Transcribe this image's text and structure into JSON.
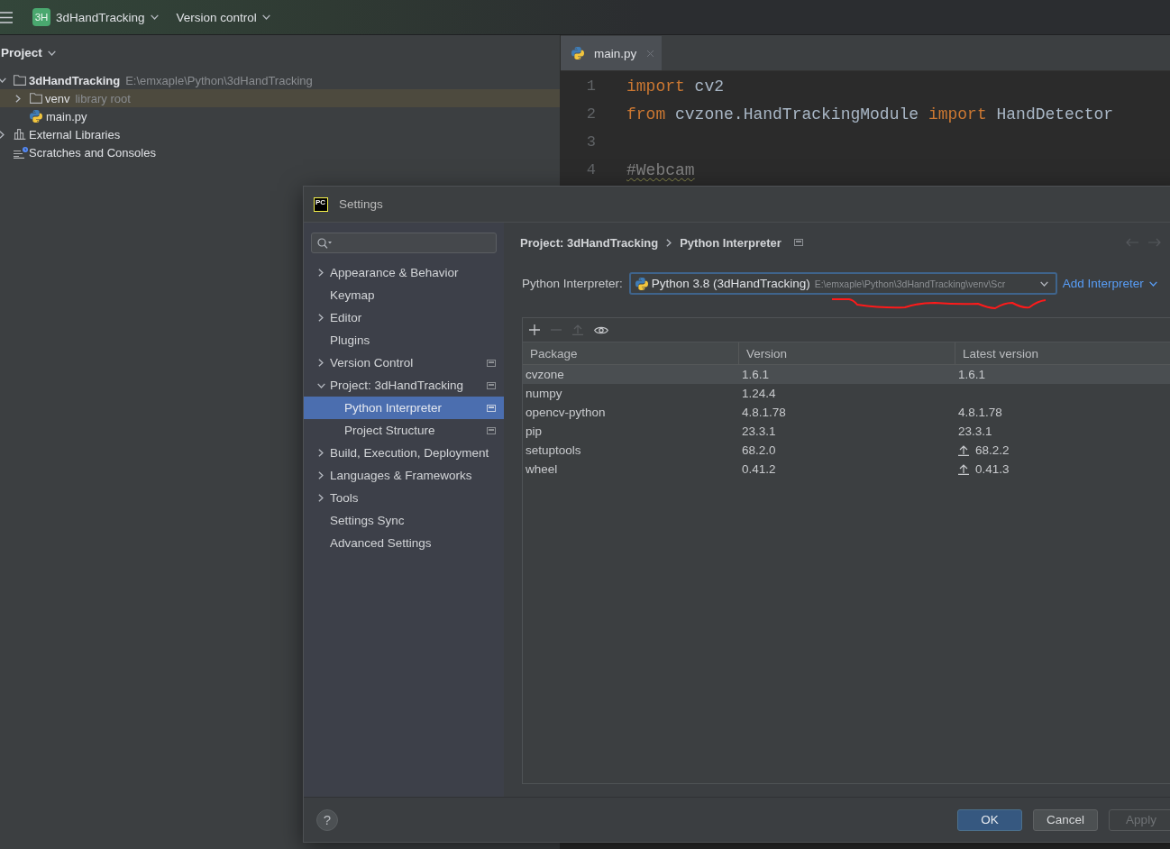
{
  "main_toolbar": {
    "project_badge": "3H",
    "project": "3dHandTracking",
    "vcs": "Version control"
  },
  "project_panel": {
    "title": "Project",
    "tree": [
      {
        "kind": "project",
        "name": "3dHandTracking",
        "hint": "E:\\emxaple\\Python\\3dHandTracking",
        "expanded": true,
        "selected": false,
        "children": [
          {
            "kind": "folder",
            "name": "venv",
            "hint": "library root",
            "expanded": false,
            "selected": true
          },
          {
            "kind": "python",
            "name": "main.py",
            "selected": false
          }
        ]
      },
      {
        "kind": "libraries",
        "name": "External Libraries",
        "expanded": false,
        "selected": false
      },
      {
        "kind": "scratches",
        "name": "Scratches and Consoles",
        "selected": false
      }
    ]
  },
  "editor": {
    "tabs": [
      {
        "label": "main.py",
        "selected": true
      }
    ],
    "lines": [
      {
        "number": "1",
        "tokens": [
          {
            "kind": "keyword",
            "text": "import"
          },
          {
            "kind": "plain",
            "text": " cv2"
          }
        ]
      },
      {
        "number": "2",
        "tokens": [
          {
            "kind": "keyword",
            "text": "from"
          },
          {
            "kind": "plain",
            "text": " cvzone.HandTrackingModule "
          },
          {
            "kind": "keyword",
            "text": "import"
          },
          {
            "kind": "plain",
            "text": " HandDetector"
          }
        ]
      },
      {
        "number": "3"
      },
      {
        "number": "4",
        "tokens": [
          {
            "kind": "comment",
            "text": "#Webcam",
            "typo": true
          }
        ]
      }
    ]
  },
  "settings_dialog": {
    "logo": "PC",
    "title": "Settings",
    "nav": [
      {
        "label": "Appearance & Behavior",
        "expanded": false,
        "project_scope": false,
        "selected": false
      },
      {
        "label": "Keymap",
        "project_scope": false,
        "selected": false
      },
      {
        "label": "Editor",
        "expanded": false,
        "project_scope": false,
        "selected": false
      },
      {
        "label": "Plugins",
        "project_scope": false,
        "selected": false
      },
      {
        "label": "Version Control",
        "expanded": false,
        "project_scope": true,
        "selected": false
      },
      {
        "label": "Project: 3dHandTracking",
        "expanded": true,
        "project_scope": true,
        "selected": false,
        "children": [
          {
            "label": "Python Interpreter",
            "project_scope": true,
            "selected": true
          },
          {
            "label": "Project Structure",
            "project_scope": true,
            "selected": false
          }
        ]
      },
      {
        "label": "Build, Execution, Deployment",
        "expanded": false,
        "project_scope": false,
        "selected": false
      },
      {
        "label": "Languages & Frameworks",
        "expanded": false,
        "project_scope": false,
        "selected": false
      },
      {
        "label": "Tools",
        "expanded": false,
        "project_scope": false,
        "selected": false
      },
      {
        "label": "Settings Sync",
        "project_scope": false,
        "selected": false
      },
      {
        "label": "Advanced Settings",
        "project_scope": false,
        "selected": false
      }
    ],
    "breadcrumb": [
      "Project: 3dHandTracking",
      "Python Interpreter"
    ],
    "interpreter": {
      "label": "Python Interpreter:",
      "value": "Python 3.8 (3dHandTracking)",
      "path": "E:\\emxaple\\Python\\3dHandTracking\\venv\\Scr"
    },
    "add_interpreter": "Add Interpreter",
    "package_tools": [
      {
        "kind": "add",
        "disabled": false
      },
      {
        "kind": "remove",
        "disabled": true
      },
      {
        "kind": "upgrade",
        "disabled": true
      },
      {
        "kind": "show-early-releases",
        "disabled": false
      }
    ],
    "packages": {
      "columns": [
        "Package",
        "Version",
        "Latest version"
      ],
      "rows": [
        {
          "package": "cvzone",
          "version": "1.6.1",
          "latest": "1.6.1",
          "upgrade": false,
          "selected": true
        },
        {
          "package": "numpy",
          "version": "1.24.4",
          "selected": false
        },
        {
          "package": "opencv-python",
          "version": "4.8.1.78",
          "latest": "4.8.1.78",
          "upgrade": false,
          "selected": false
        },
        {
          "package": "pip",
          "version": "23.3.1",
          "latest": "23.3.1",
          "upgrade": false,
          "selected": false
        },
        {
          "package": "setuptools",
          "version": "68.2.0",
          "latest": "68.2.2",
          "upgrade": true,
          "selected": false
        },
        {
          "package": "wheel",
          "version": "0.41.2",
          "latest": "0.41.3",
          "upgrade": true,
          "selected": false
        }
      ]
    },
    "help": "?",
    "buttons": [
      {
        "label": "OK",
        "kind": "primary",
        "disabled": false
      },
      {
        "label": "Cancel",
        "kind": "secondary",
        "disabled": false
      },
      {
        "label": "Apply",
        "kind": "secondary",
        "disabled": true
      }
    ]
  }
}
